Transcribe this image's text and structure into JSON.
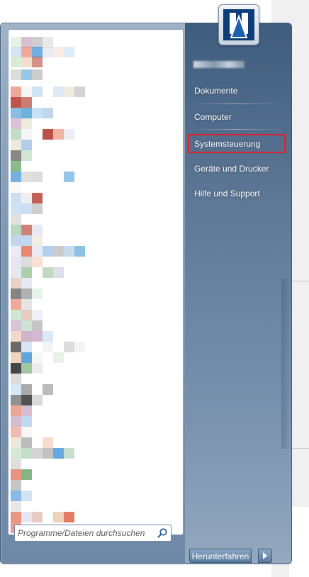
{
  "start_menu": {
    "search": {
      "placeholder": "Programme/Dateien durchsuchen",
      "value": ""
    },
    "user": {
      "name": ""
    },
    "nav_items": [
      {
        "label": "Dokumente",
        "highlighted": false
      },
      {
        "label": "Computer",
        "highlighted": false
      },
      {
        "label": "Systemsteuerung",
        "highlighted": true
      },
      {
        "label": "Geräte und Drucker",
        "highlighted": false
      },
      {
        "label": "Hilfe und Support",
        "highlighted": false
      }
    ],
    "shutdown_label": "Herunterfahren",
    "icons": {
      "avatar": "user-avatar-icon",
      "search": "search-icon",
      "shutdown_options": "chevron-right-icon"
    },
    "colors": {
      "frame": "#7f98b3",
      "right_pane": "#4d6a8c",
      "highlight_border": "#e0202a",
      "left_pane": "#ffffff"
    },
    "program_list": {
      "note": "",
      "rows": 48
    }
  }
}
